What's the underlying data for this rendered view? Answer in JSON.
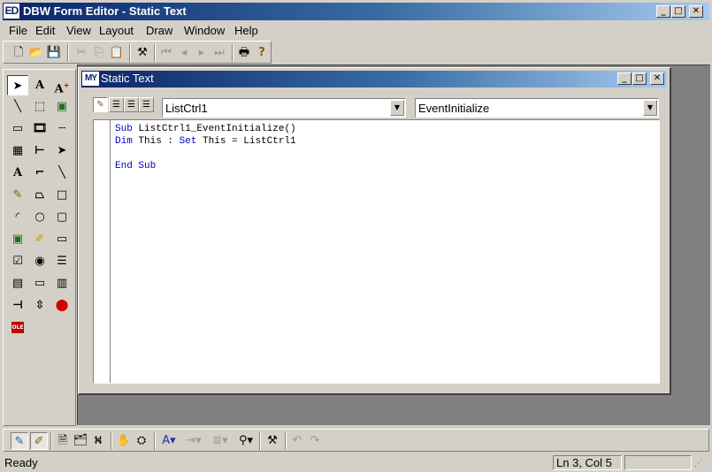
{
  "app": {
    "icon_text": "ED",
    "title": "DBW Form Editor - Static Text",
    "caption_buttons": {
      "minimize": "_",
      "maximize": "□",
      "close": "✕"
    }
  },
  "menu": [
    "File",
    "Edit",
    "View",
    "Layout",
    "Draw",
    "Window",
    "Help"
  ],
  "toolbar": {
    "icons": [
      "new-file-icon",
      "open-folder-icon",
      "save-icon",
      "cut-icon",
      "copy-icon",
      "paste-icon",
      "magic-wand-icon",
      "first-record-icon",
      "previous-record-icon",
      "next-record-icon",
      "last-record-icon",
      "print-icon",
      "help-icon"
    ]
  },
  "palette": {
    "text_tool": "A",
    "text_tool_plus": "A",
    "label_tool": "A",
    "ole_label": "OLE"
  },
  "child": {
    "icon_text": "MY",
    "title": "Static Text",
    "object_combo": "ListCtrl1",
    "event_combo": "EventInitialize",
    "code": {
      "line1_kw": "Sub",
      "line1_rest": " ListCtrl1_EventInitialize()",
      "line2_kw1": "Dim",
      "line2_mid": " This : ",
      "line2_kw2": "Set",
      "line2_rest": " This = ListCtrl1",
      "line4": "End Sub"
    }
  },
  "status": {
    "ready": "Ready",
    "position": "Ln 3, Col 5"
  },
  "colors": {
    "title_gradient_start": "#0a246a",
    "title_gradient_end": "#a6caf0",
    "keyword": "#0000c0",
    "face": "#d4d0c8",
    "workspace": "#808080"
  }
}
